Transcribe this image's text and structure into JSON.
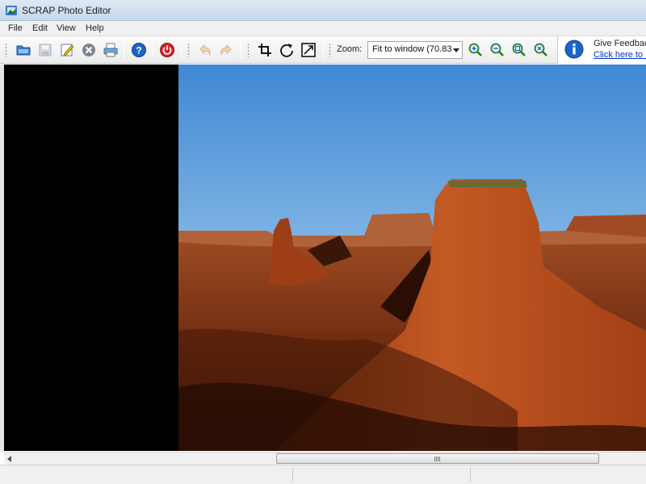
{
  "window": {
    "title": "SCRAP Photo Editor"
  },
  "menu": [
    "File",
    "Edit",
    "View",
    "Help"
  ],
  "toolbar": {
    "buttons": [
      "open-icon",
      "save-icon",
      "edit-icon",
      "close-icon",
      "print-icon",
      "help-icon",
      "exit-icon",
      "undo-icon",
      "redo-icon",
      "crop-icon",
      "rotate-icon",
      "resize-icon",
      "zoom-in-icon",
      "zoom-out-icon",
      "zoom-fit-icon",
      "zoom-actual-icon"
    ],
    "zoom_label": "Zoom:",
    "zoom_value": "Fit to window (70.83"
  },
  "feedback": {
    "title": "Give Feedback",
    "link": "Click here to r"
  },
  "colors": {
    "canvas": "#000000",
    "link": "#0033cc",
    "accent": "#1e64c8"
  }
}
